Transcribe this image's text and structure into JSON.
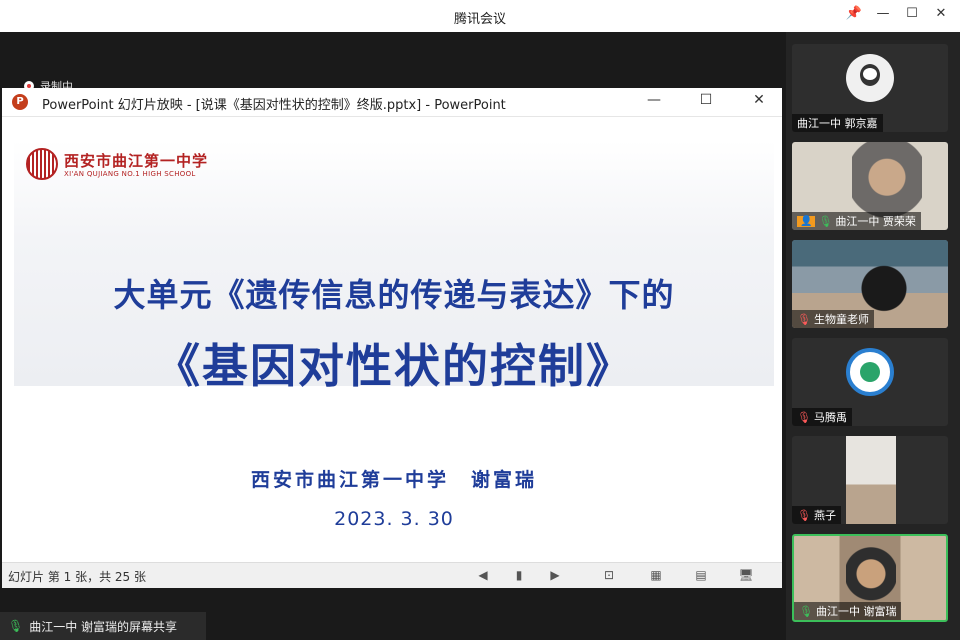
{
  "app": {
    "title": "腾讯会议"
  },
  "window_controls": {
    "pin": "📌",
    "minimize": "—",
    "maximize": "☐",
    "close": "✕"
  },
  "recording": {
    "label": "录制中"
  },
  "ppt_window": {
    "title": "PowerPoint 幻灯片放映 - [说课《基因对性状的控制》终版.pptx] - PowerPoint",
    "logo_letter": "P",
    "controls": {
      "minimize": "—",
      "maximize": "☐",
      "close": "✕"
    }
  },
  "slide": {
    "school_name": "西安市曲江第一中学",
    "school_name_en": "XI'AN QUJIANG NO.1 HIGH SCHOOL",
    "heading_line1": "大单元《遗传信息的传递与表达》下的",
    "heading_line2": "《基因对性状的控制》",
    "author": "西安市曲江第一中学　谢富瑞",
    "date": "2023. 3. 30"
  },
  "status_bar": {
    "slide_counter": "幻灯片 第 1 张，共 25 张",
    "buttons": [
      "◀",
      "▮",
      "▶",
      "⊡",
      "▦",
      "▤",
      "🖥"
    ]
  },
  "share_indicator": {
    "label": "曲江一中 谢富瑞的屏幕共享"
  },
  "participants": [
    {
      "name": "曲江一中 郭京嘉",
      "mic": "none",
      "type": "avatar",
      "color": "#f0f0f0"
    },
    {
      "name": "曲江一中 贾荣荣",
      "mic": "on",
      "type": "camera",
      "color": "#d9d3c8"
    },
    {
      "name": "生物童老师",
      "mic": "muted",
      "type": "camera",
      "color": "#6b7f8f"
    },
    {
      "name": "马腾禹",
      "mic": "muted",
      "type": "avatar",
      "color": "#2a7fd0"
    },
    {
      "name": "燕子",
      "mic": "muted",
      "type": "camera",
      "color": "#b9a48e"
    },
    {
      "name": "曲江一中 谢富瑞",
      "mic": "on",
      "type": "camera",
      "color": "#8c7a68",
      "active": true
    }
  ],
  "colors": {
    "slide_text": "#1f3d99",
    "school_red": "#b32222",
    "active_border": "#3cbf5a"
  }
}
